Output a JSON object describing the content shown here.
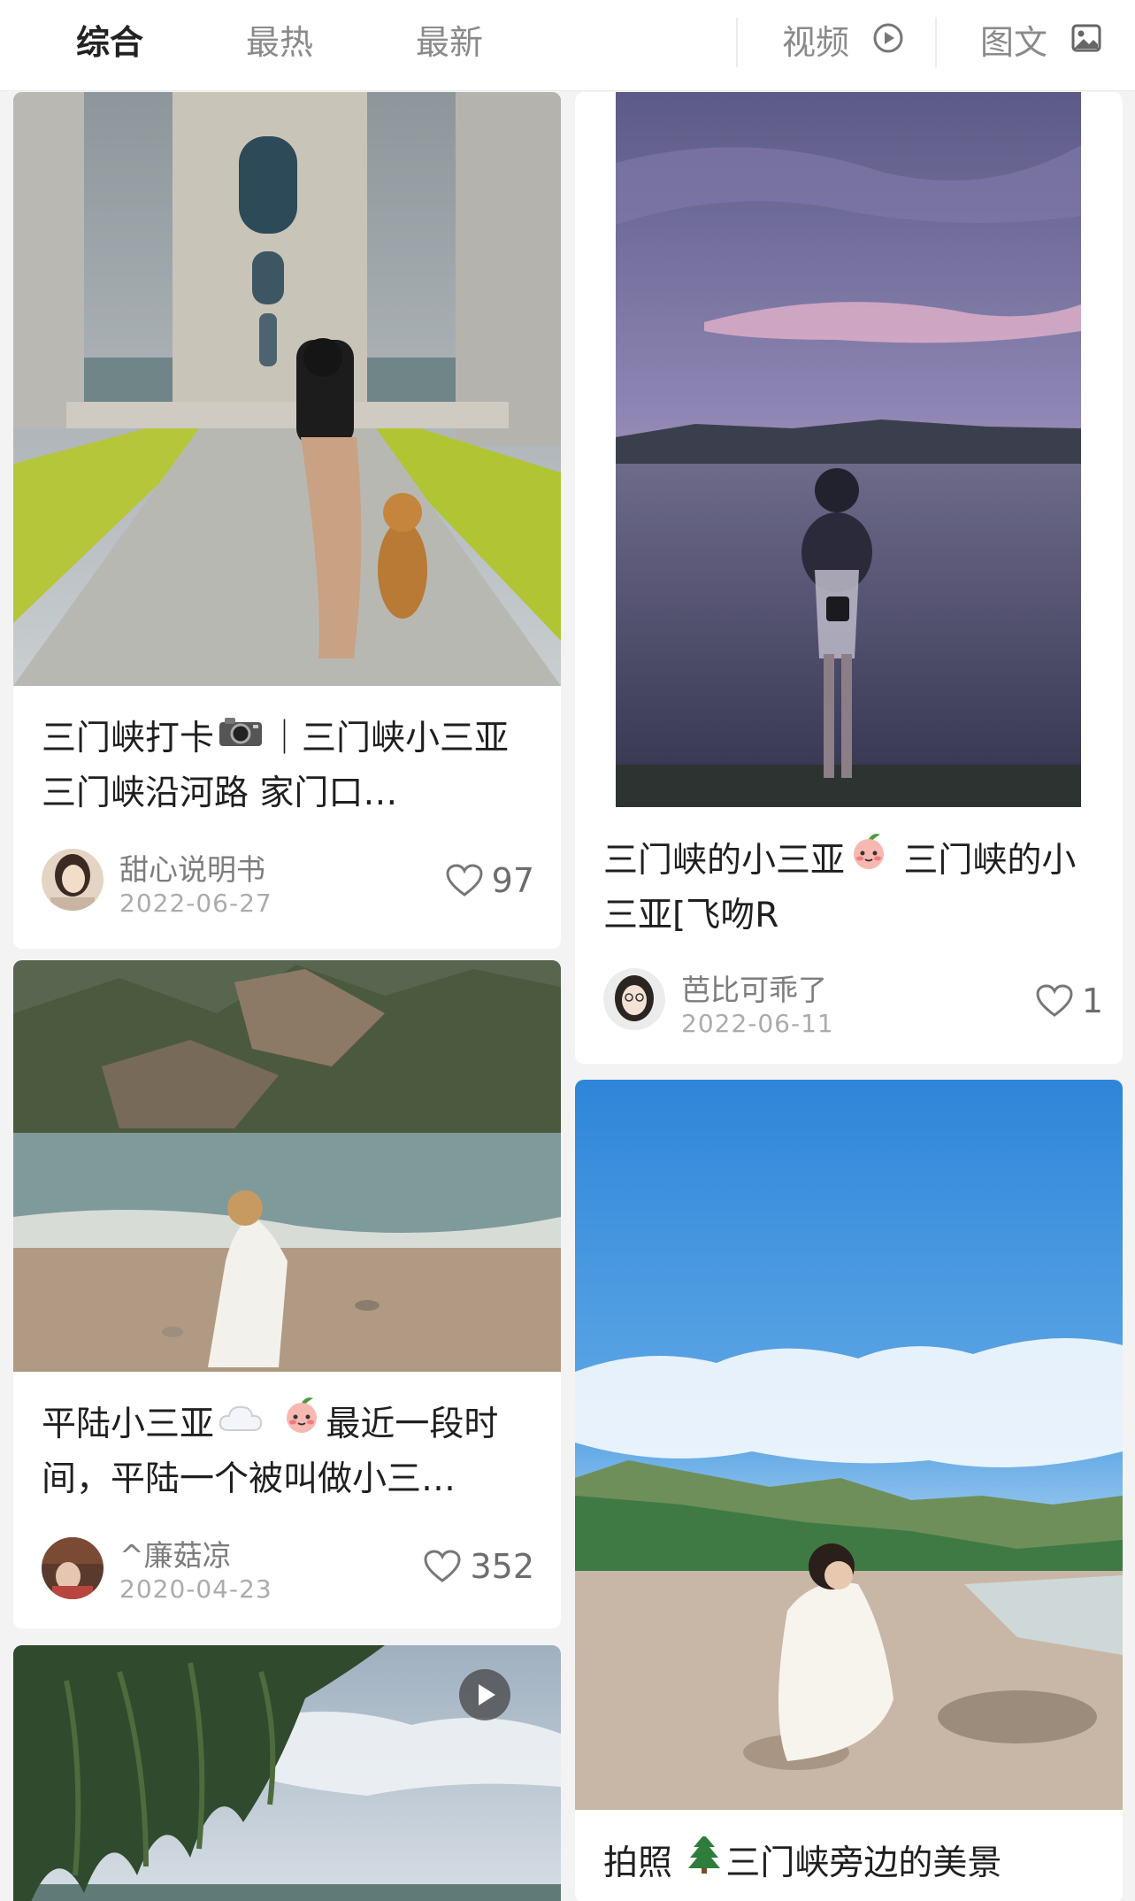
{
  "tabs": {
    "comprehensive": "综合",
    "hottest": "最热",
    "newest": "最新",
    "video": "视频",
    "image_text": "图文"
  },
  "posts": [
    {
      "title_a": "三门峡打卡",
      "title_b": "｜三门峡小三亚 三门峡沿河路 家门口…",
      "author": "甜心说明书",
      "date": "2022-06-27",
      "likes": "97"
    },
    {
      "title_a": "三门峡的小三亚",
      "title_b": " 三门峡的小三亚[飞吻R",
      "author": "芭比可乖了",
      "date": "2022-06-11",
      "likes": "1"
    },
    {
      "title_a": "平陆小三亚",
      "title_b": "最近一段时间，平陆一个被叫做小三…",
      "author": "^廉菇凉",
      "date": "2020-04-23",
      "likes": "352"
    },
    {
      "title_a": "拍照",
      "title_b": "三门峡旁边的美景"
    }
  ],
  "icons": {
    "video_tab": "play-circle-icon",
    "image_tab": "image-icon",
    "like": "heart-outline-icon",
    "camera_emoji": "camera-icon",
    "peach_emoji": "peach-face-icon",
    "cloud_emoji": "cloud-icon",
    "tree_emoji": "tree-icon",
    "play_badge": "play-icon"
  },
  "colors": {
    "active_tab": "#222222",
    "inactive_tab": "#8a8a8a",
    "background": "#f3f3f3"
  }
}
